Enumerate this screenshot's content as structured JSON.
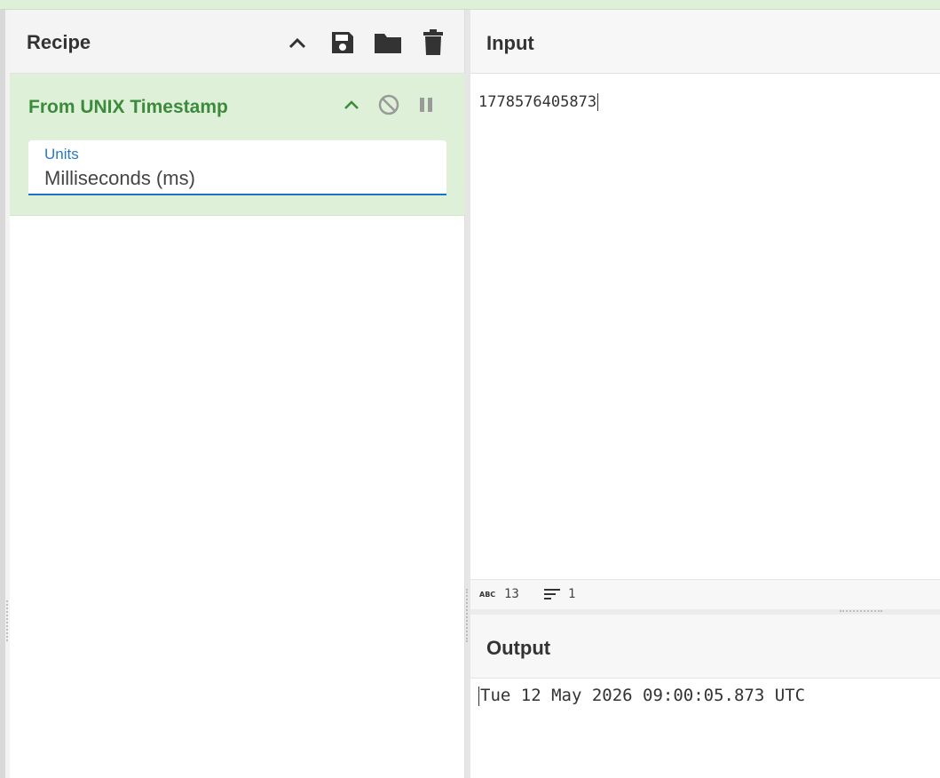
{
  "recipe": {
    "title": "Recipe",
    "icons": [
      "chevron-up-icon",
      "save-icon",
      "folder-icon",
      "trash-icon"
    ]
  },
  "operation": {
    "title": "From UNIX Timestamp",
    "field_label": "Units",
    "field_value": "Milliseconds (ms)",
    "icons": [
      "chevron-up-icon",
      "disable-icon",
      "pause-icon"
    ]
  },
  "input": {
    "title": "Input",
    "value": "1778576405873",
    "char_count": "13",
    "line_count": "1"
  },
  "output": {
    "title": "Output",
    "value": "Tue 12 May 2026 09:00:05.873 UTC"
  },
  "colors": {
    "operation_bg": "#dff0d8",
    "operation_title": "#3c8b3c",
    "field_accent": "#1a73c8"
  }
}
